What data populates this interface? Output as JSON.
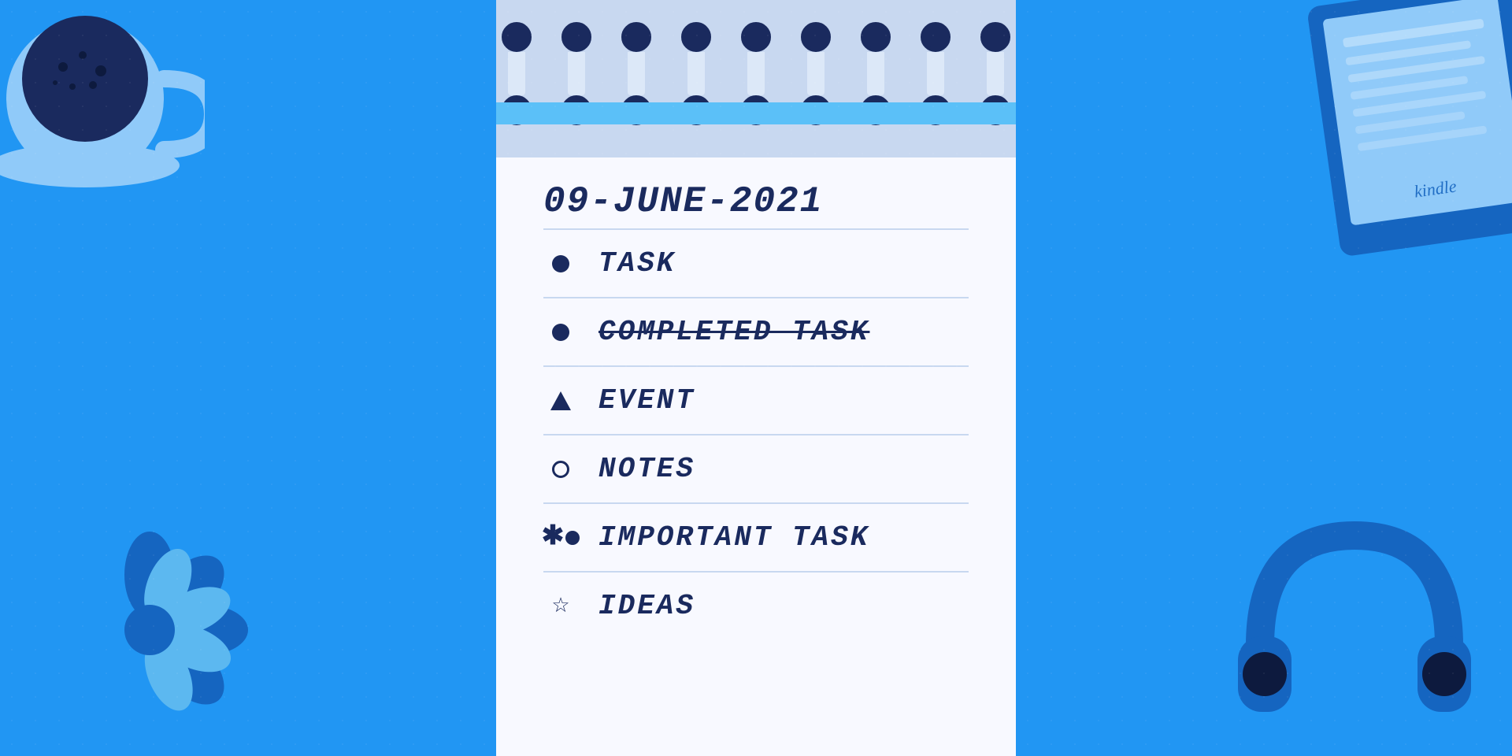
{
  "background": {
    "color": "#2196f3"
  },
  "notebook": {
    "date": "09-June-2021",
    "spirals_count": 9,
    "items": [
      {
        "id": "task",
        "icon": "bullet-filled",
        "label": "Task",
        "completed": false
      },
      {
        "id": "completed-task",
        "icon": "bullet-filled",
        "label": "Completed Task",
        "completed": true
      },
      {
        "id": "event",
        "icon": "triangle",
        "label": "Event",
        "completed": false
      },
      {
        "id": "notes",
        "icon": "circle-hollow",
        "label": "Notes",
        "completed": false
      },
      {
        "id": "important-task",
        "icon": "important",
        "label": "Important Task",
        "completed": false
      },
      {
        "id": "ideas",
        "icon": "star",
        "label": "Ideas",
        "completed": false
      }
    ]
  },
  "decorations": {
    "coffee_cup": {
      "label": "Coffee cup"
    },
    "kindle": {
      "label": "Kindle e-reader",
      "brand": "kindle"
    },
    "flower": {
      "label": "Decorative flower"
    },
    "headphones": {
      "label": "Headphones"
    }
  }
}
